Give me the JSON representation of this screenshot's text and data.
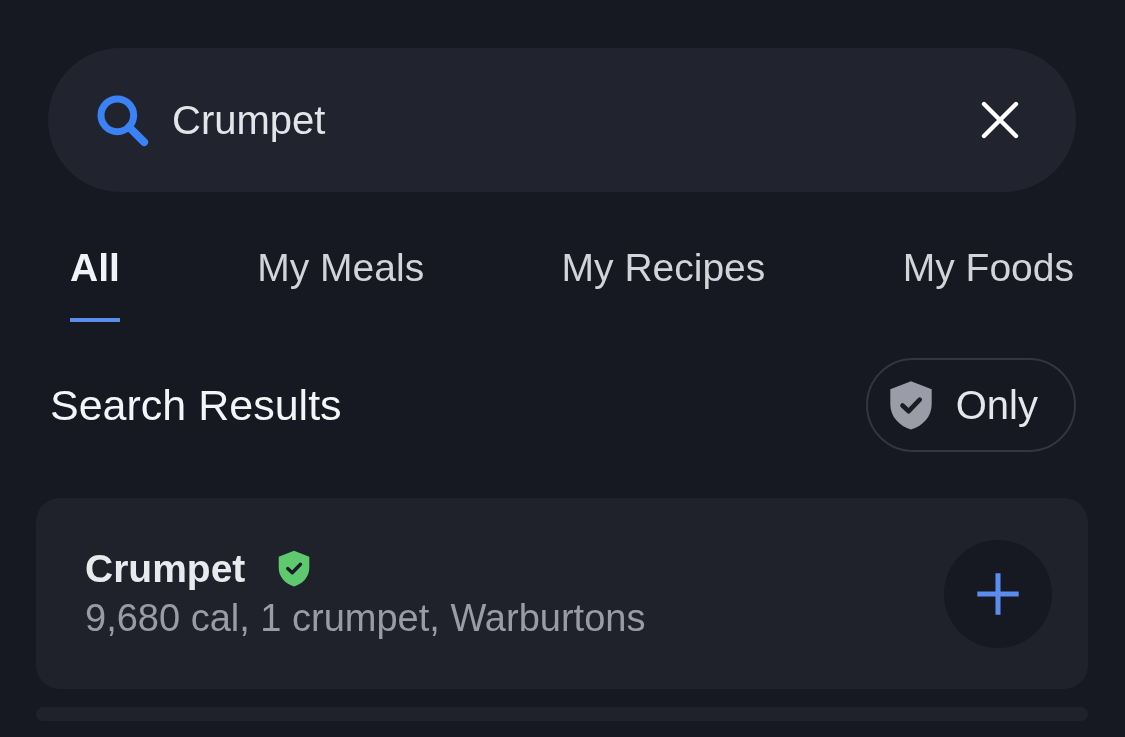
{
  "search": {
    "value": "Crumpet"
  },
  "tabs": [
    {
      "label": "All",
      "selected": true
    },
    {
      "label": "My Meals",
      "selected": false
    },
    {
      "label": "My Recipes",
      "selected": false
    },
    {
      "label": "My Foods",
      "selected": false
    }
  ],
  "results": {
    "title": "Search Results",
    "verified_filter": {
      "label": "Only",
      "on": false
    },
    "items": [
      {
        "name": "Crumpet",
        "verified": true,
        "details": "9,680 cal, 1 crumpet, Warburtons"
      }
    ]
  }
}
